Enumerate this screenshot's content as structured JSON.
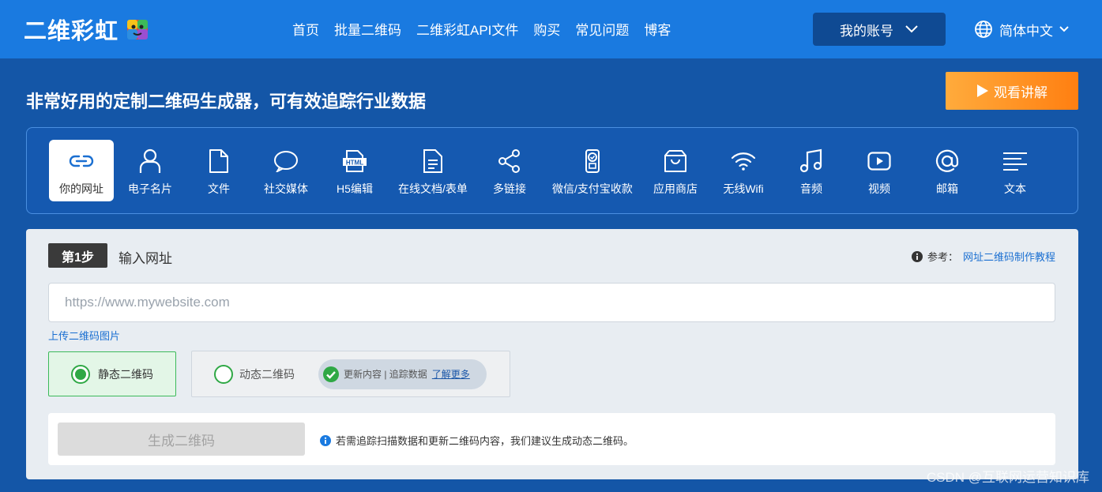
{
  "header": {
    "logo_text": "二维彩虹",
    "nav": [
      "首页",
      "批量二维码",
      "二维彩虹API文件",
      "购买",
      "常见问题",
      "博客"
    ],
    "account_label": "我的账号",
    "language_label": "简体中文"
  },
  "hero": {
    "headline": "非常好用的定制二维码生成器，可有效追踪行业数据",
    "watch_button": "观看讲解"
  },
  "types": [
    {
      "label": "你的网址",
      "icon": "link-icon",
      "active": true
    },
    {
      "label": "电子名片",
      "icon": "person-icon",
      "active": false
    },
    {
      "label": "文件",
      "icon": "file-icon",
      "active": false
    },
    {
      "label": "社交媒体",
      "icon": "chat-bubble-icon",
      "active": false
    },
    {
      "label": "H5编辑",
      "icon": "html-icon",
      "active": false
    },
    {
      "label": "在线文档/表单",
      "icon": "document-icon",
      "active": false
    },
    {
      "label": "多链接",
      "icon": "share-icon",
      "active": false
    },
    {
      "label": "微信/支付宝收款",
      "icon": "payment-icon",
      "active": false
    },
    {
      "label": "应用商店",
      "icon": "shopping-bag-icon",
      "active": false
    },
    {
      "label": "无线Wifi",
      "icon": "wifi-icon",
      "active": false
    },
    {
      "label": "音频",
      "icon": "music-note-icon",
      "active": false
    },
    {
      "label": "视频",
      "icon": "video-play-icon",
      "active": false
    },
    {
      "label": "邮箱",
      "icon": "at-sign-icon",
      "active": false
    },
    {
      "label": "文本",
      "icon": "text-lines-icon",
      "active": false
    }
  ],
  "step": {
    "badge": "第1步",
    "title": "输入网址",
    "reference_label": "参考：",
    "reference_link": "网址二维码制作教程",
    "url_placeholder": "https://www.mywebsite.com",
    "url_value": "",
    "upload_link": "上传二维码图片",
    "static_option": "静态二维码",
    "dynamic_option": "动态二维码",
    "dynamic_feature": "更新内容 | 追踪数据",
    "learn_more": "了解更多",
    "generate_button": "生成二维码",
    "tip": "若需追踪扫描数据和更新二维码内容，我们建议生成动态二维码。"
  },
  "watermark": "CSDN @互联网运营知识库",
  "colors": {
    "header_bg": "#1a7ae0",
    "page_bg": "#1456a7",
    "orange": "#ff8a1f",
    "green": "#2fa845",
    "link": "#1a6fd1"
  }
}
